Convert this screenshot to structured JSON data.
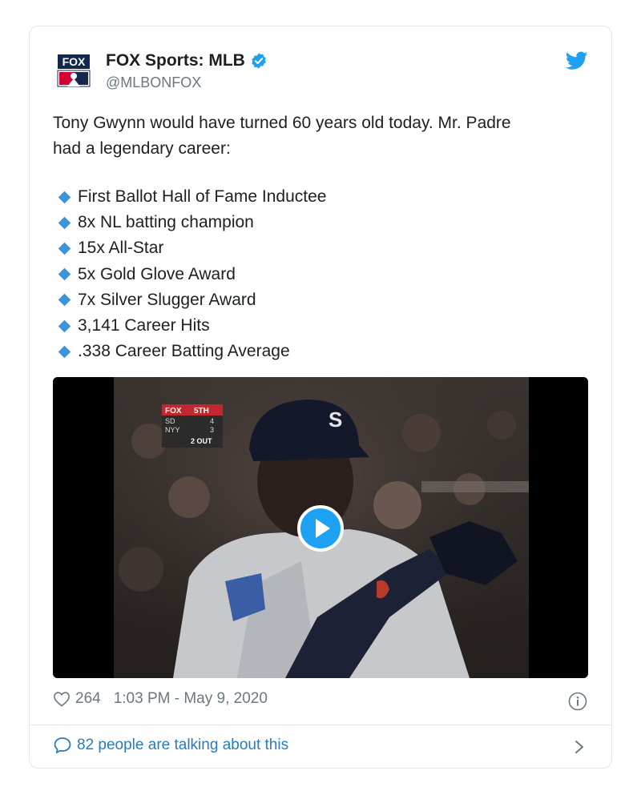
{
  "author": {
    "name": "FOX Sports: MLB",
    "handle": "@MLBONFOX",
    "avatar_text": "FOX",
    "verified": true
  },
  "tweet": {
    "intro_line1": "Tony Gwynn would have turned 60 years old today. Mr. Padre",
    "intro_line2": "had a legendary career:",
    "achievements": [
      "First Ballot Hall of Fame Inductee",
      "8x NL batting champion",
      "15x All-Star",
      "5x Gold Glove Award",
      "7x Silver Slugger Award",
      "3,141 Career Hits",
      ".338 Career Batting Average"
    ]
  },
  "video": {
    "scorebug": {
      "network": "FOX",
      "inning": "5TH",
      "team1": "SD",
      "score1": "4",
      "team2": "NYY",
      "score2": "3",
      "outs": "2 OUT"
    },
    "helmet_logo": "S"
  },
  "footer": {
    "likes": "264",
    "timestamp": "1:03 PM - May 9, 2020",
    "talking": "82 people are talking about this"
  },
  "icons": {
    "verified": "verified-badge-icon",
    "twitter": "twitter-bird-icon",
    "like": "heart-icon",
    "info": "info-icon",
    "reply": "speech-bubble-icon",
    "chevron": "chevron-right-icon",
    "play": "play-icon"
  },
  "colors": {
    "accent": "#1da1f2",
    "link": "#2b7bb9",
    "muted": "#697882",
    "bullet": "#3b94d9"
  }
}
